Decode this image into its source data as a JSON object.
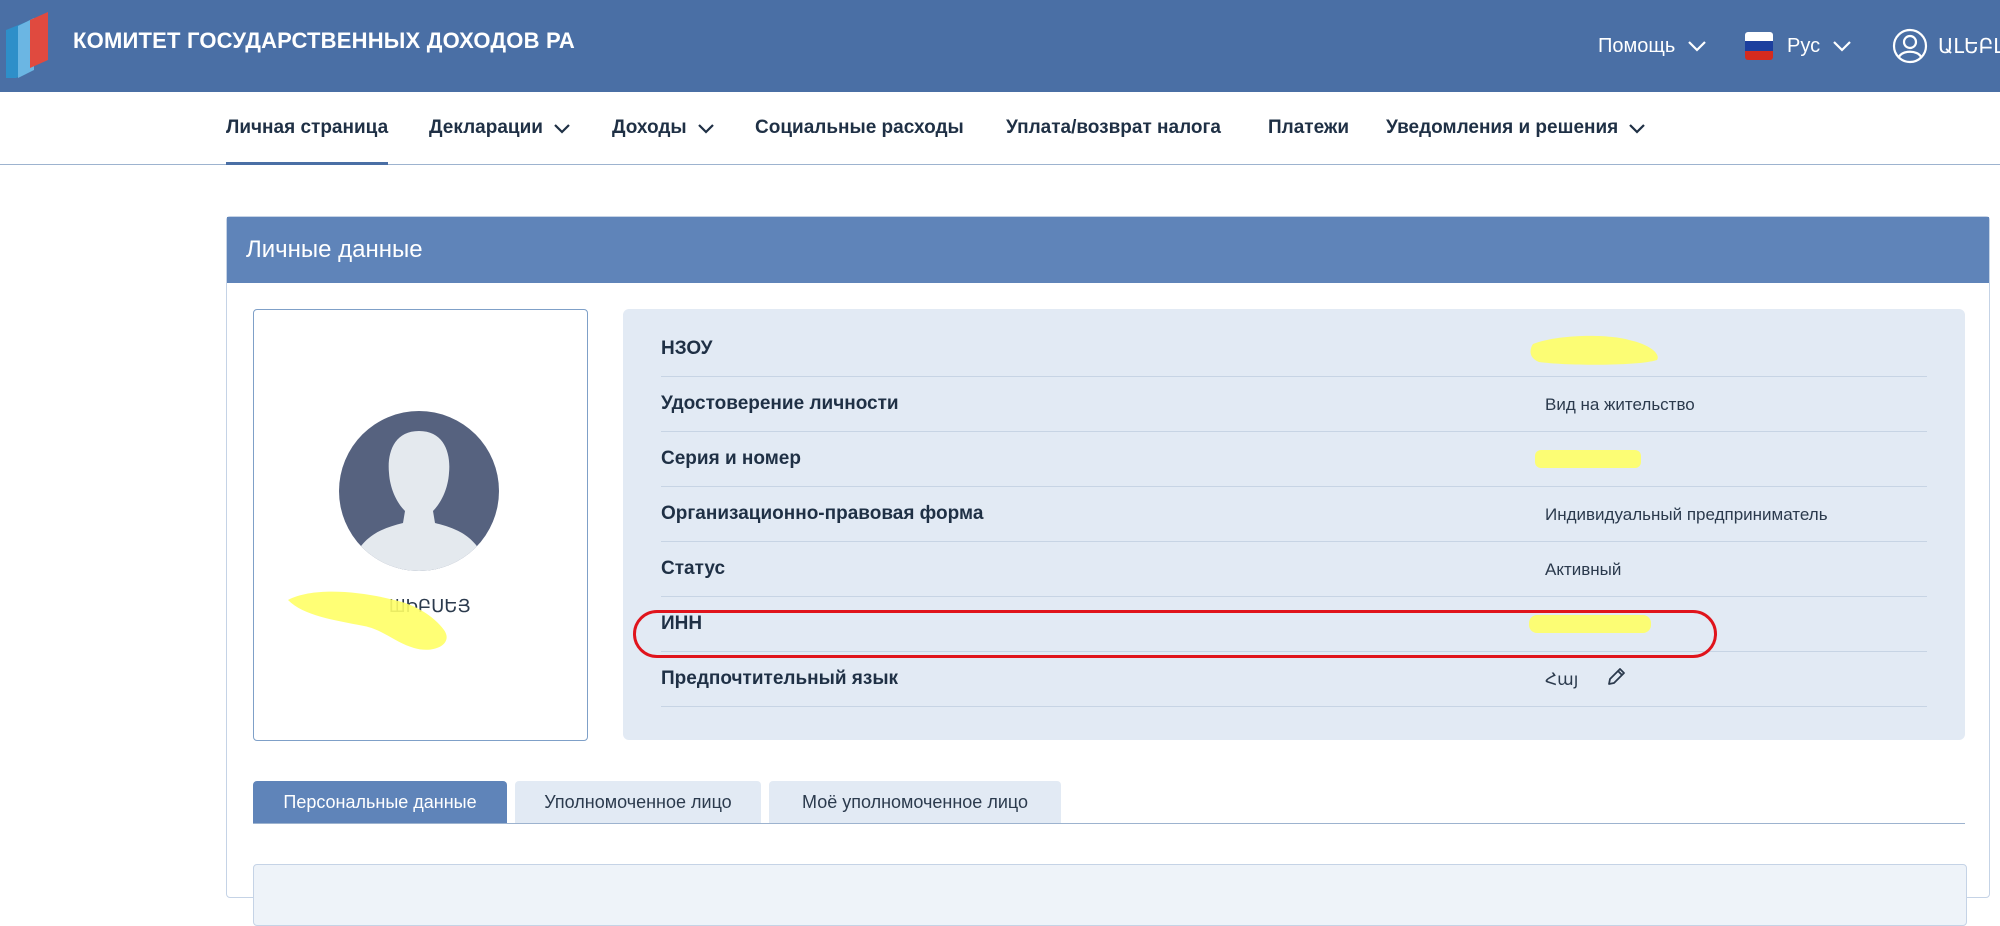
{
  "header": {
    "brand": "КОМИТЕТ ГОСУДАРСТВЕННЫХ ДОХОДОВ РА",
    "help_label": "Помощь",
    "language_label": "Рус",
    "user_label": "ԱԼԵԲԼ"
  },
  "nav": {
    "items": [
      {
        "label": "Личная страница"
      },
      {
        "label": "Декларации"
      },
      {
        "label": "Доходы"
      },
      {
        "label": "Социальные расходы"
      },
      {
        "label": "Уплата/возврат налога"
      },
      {
        "label": "Платежи"
      },
      {
        "label": "Уведомления и решения"
      }
    ]
  },
  "panel": {
    "title": "Личные данные",
    "profile": {
      "name_fragment": "ШԻԲՍԵՅ"
    },
    "rows": [
      {
        "label": "НЗОУ",
        "value": ""
      },
      {
        "label": "Удостоверение личности",
        "value": "Вид на жительство"
      },
      {
        "label": "Серия и номер",
        "value": ""
      },
      {
        "label": "Организационно-правовая форма",
        "value": "Индивидуальный предприниматель"
      },
      {
        "label": "Статус",
        "value": "Активный"
      },
      {
        "label": "ИНН",
        "value": ""
      },
      {
        "label": "Предпочтительный язык",
        "value": "Հայ"
      }
    ]
  },
  "tabs": [
    {
      "label": "Персональные данные"
    },
    {
      "label": "Уполномоченное лицо"
    },
    {
      "label": "Моё уполномоченное лицо"
    }
  ],
  "colors": {
    "header_bg": "#4a6fa5",
    "panel_head_bg": "#5f84b9",
    "info_bg": "#e2eaf4",
    "highlight": "#e0141c",
    "redaction": "#ffff66"
  }
}
